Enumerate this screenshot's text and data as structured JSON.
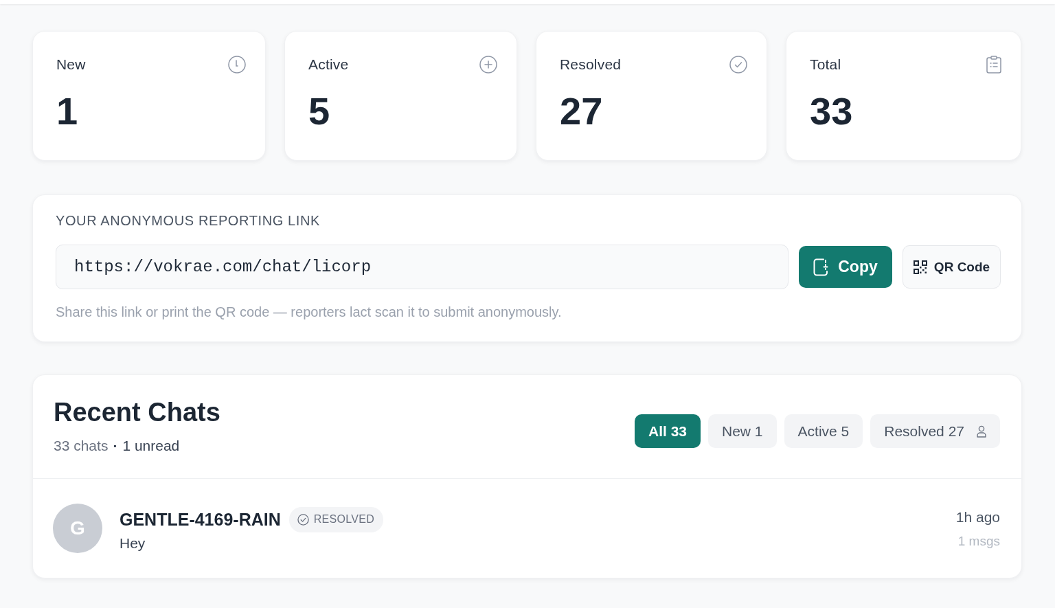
{
  "stats": [
    {
      "label": "New",
      "value": "1"
    },
    {
      "label": "Active",
      "value": "5"
    },
    {
      "label": "Resolved",
      "value": "27"
    },
    {
      "label": "Total",
      "value": "33"
    }
  ],
  "reporting_link": {
    "title": "YOUR ANONYMOUS REPORTING LINK",
    "url": "https://vokrae.com/chat/licorp",
    "buttons": [
      {
        "label": "Copy",
        "kind": "primary"
      },
      {
        "label": "QR Code",
        "kind": "secondary"
      }
    ],
    "help": "Share this link or print the QR code — reporters lact scan it to submit anonymously."
  },
  "recent_chats": {
    "title": "Recent Chats",
    "count": "33 chats",
    "separator": "·",
    "unread": "1 unread",
    "filters": [
      {
        "label": "All 33",
        "selected": true
      },
      {
        "label": "New 1",
        "selected": false
      },
      {
        "label": "Active 5",
        "selected": false
      },
      {
        "label": "Resolved 27",
        "selected": false
      }
    ],
    "items": [
      {
        "avatar_letter": "G",
        "name": "GENTLE-4169-RAIN",
        "status": "RESOLVED",
        "message": "Hey",
        "time": "1h ago",
        "messages": "1 msgs"
      }
    ]
  }
}
